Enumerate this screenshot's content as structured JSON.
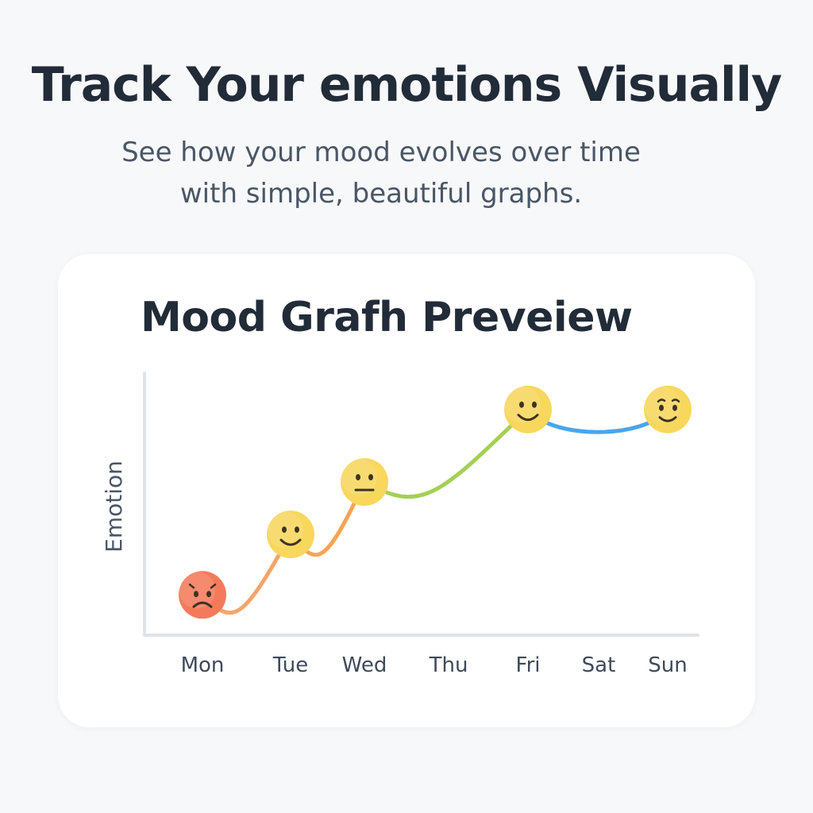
{
  "hero": {
    "title": "Track Your emotions Visually",
    "subtitle_line1": "See how your mood evolves over time",
    "subtitle_line2": "with simple, beautiful graphs."
  },
  "card": {
    "title": "Mood Grafh Preveiew"
  },
  "chart_data": {
    "type": "line",
    "title": "Mood Grafh Preveiew",
    "xlabel": "",
    "ylabel": "Emotion",
    "categories": [
      "Mon",
      "Tue",
      "Wed",
      "Thu",
      "Fri",
      "Sat",
      "Sun"
    ],
    "points": [
      {
        "x": "Mon",
        "y": 1,
        "face": "sad",
        "color": "#f08a6a"
      },
      {
        "x": "Tue",
        "y": 2.5,
        "face": "smile",
        "color": "#f6a46a"
      },
      {
        "x": "Wed",
        "y": 3.8,
        "face": "neutral",
        "color": "#f8a356"
      },
      {
        "x": "Fri",
        "y": 5.6,
        "face": "smile",
        "color": "#a5cf55"
      },
      {
        "x": "Sun",
        "y": 5.6,
        "face": "wink",
        "color": "#4ba5ea"
      }
    ],
    "ylim": [
      0,
      6.5
    ],
    "grid": false,
    "legend": "none",
    "colors": {
      "axis": "#dfe3ea",
      "face_fill": "#f8d75d",
      "face_sad_fill": "#f57a5c",
      "features": "#3e3322"
    }
  }
}
